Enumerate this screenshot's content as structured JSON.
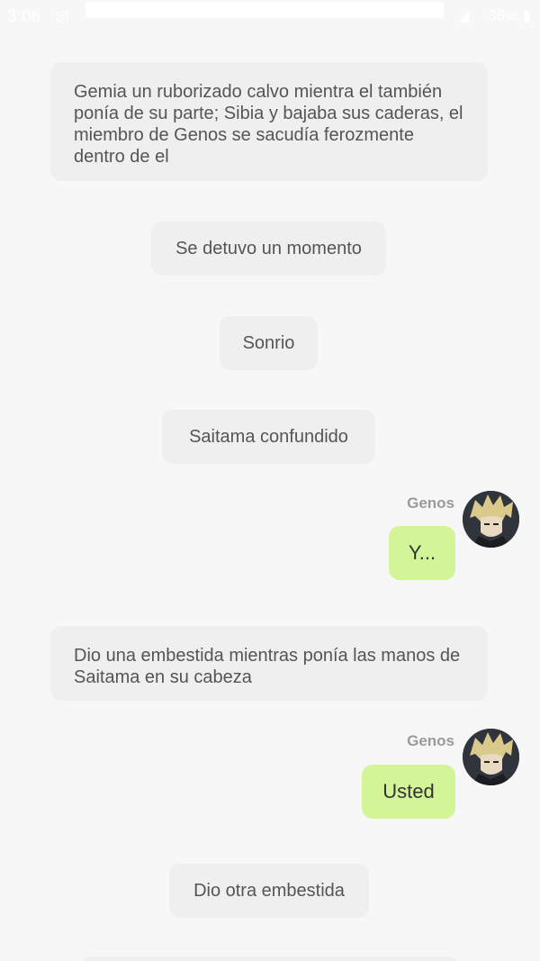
{
  "status_bar": {
    "time": "3:06",
    "battery": "36%"
  },
  "messages": [
    {
      "type": "narration",
      "text": "Gemia un ruborizado calvo mientra el también ponía de su parte; Sibia y bajaba sus caderas, el miembro de Genos se sacudía ferozmente dentro de el"
    },
    {
      "type": "narration",
      "text": "Se detuvo un momento"
    },
    {
      "type": "narration",
      "text": "Sonrio"
    },
    {
      "type": "narration",
      "text": "Saitama confundido"
    },
    {
      "type": "character",
      "name": "Genos",
      "text": "Y..."
    },
    {
      "type": "narration",
      "text": "Dio una embestida mientras ponía las manos de Saitama en su cabeza"
    },
    {
      "type": "character",
      "name": "Genos",
      "text": "Usted"
    },
    {
      "type": "narration",
      "text": "Dio otra embestida"
    }
  ],
  "colors": {
    "background": "#f7f7f7",
    "narration_bubble": "#efefef",
    "character_bubble": "#d3f597"
  },
  "icons": [
    "avatar-genos",
    "battery-icon",
    "signal-icon"
  ]
}
